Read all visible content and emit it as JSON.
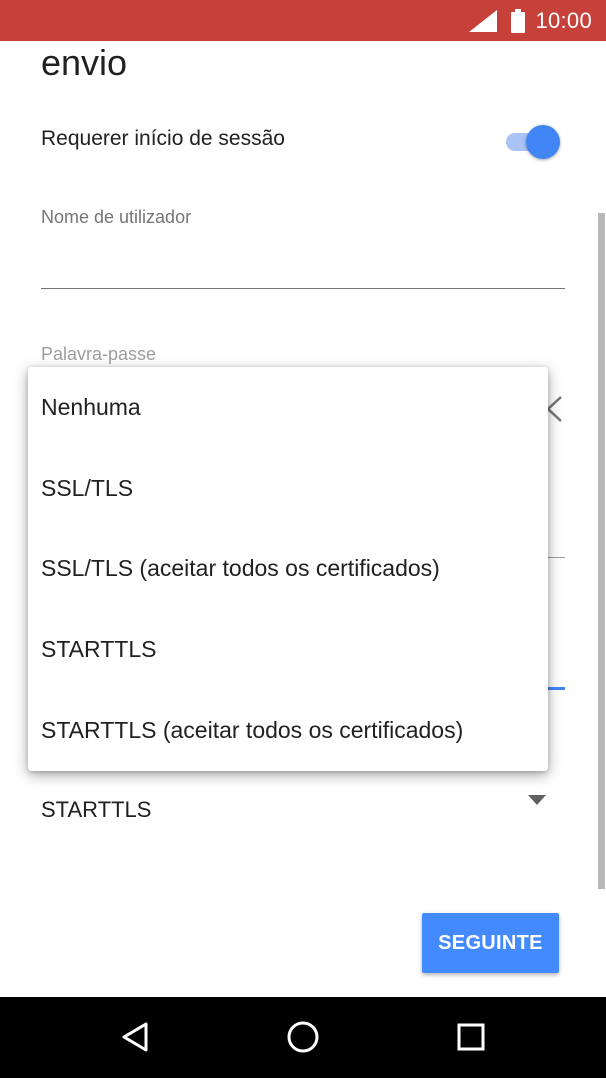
{
  "status_bar": {
    "time": "10:00"
  },
  "form": {
    "section_title": "envio",
    "require_login_label": "Requerer início de sessão",
    "require_login_on": true,
    "username_label": "Nome de utilizador",
    "username_value": "",
    "password_label": "Palavra-passe",
    "security_type_value": "STARTTLS"
  },
  "security_menu": {
    "options": [
      "Nenhuma",
      "SSL/TLS",
      "SSL/TLS (aceitar todos os certificados)",
      "STARTTLS",
      "STARTTLS (aceitar todos os certificados)"
    ]
  },
  "actions": {
    "next_label": "SEGUINTE"
  },
  "colors": {
    "status_bar": "#c5413a",
    "accent": "#4285f4",
    "button": "#448aff",
    "nav_bar": "#000000"
  },
  "icons": {
    "status": [
      "signal-icon",
      "battery-icon"
    ],
    "nav": [
      "back-icon",
      "home-icon",
      "recent-apps-icon"
    ]
  }
}
